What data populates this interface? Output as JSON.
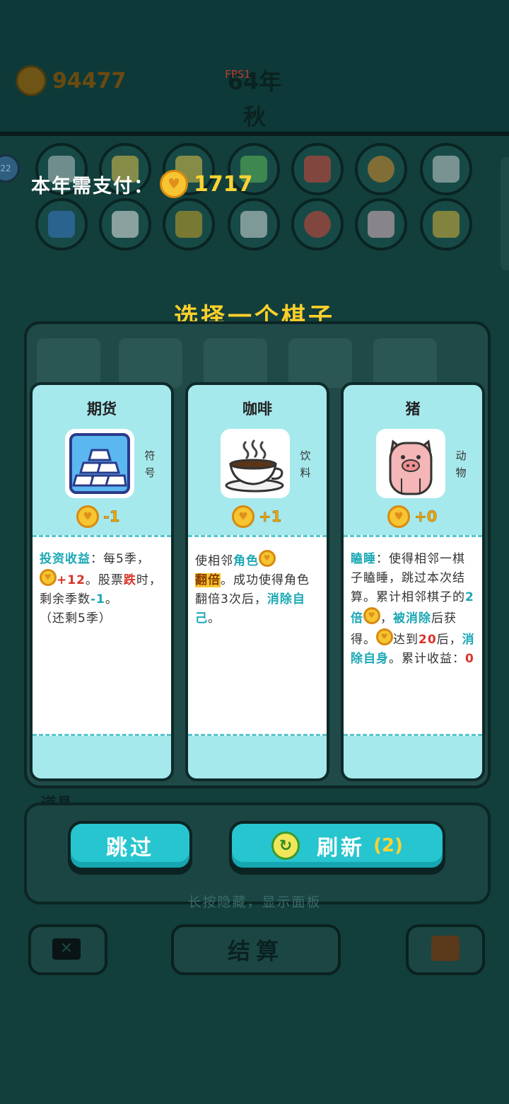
{
  "header": {
    "coins": "94477",
    "year": "64年",
    "season": "秋",
    "fps_label": "FPS1",
    "side_badge": "22"
  },
  "pay": {
    "label": "本年需支付：",
    "amount": "1717"
  },
  "choose_title": "选择一个棋子",
  "cards": [
    {
      "name": "期货",
      "category": "符号",
      "cost": "-1",
      "icon": "gold-bars-icon",
      "desc": {
        "line1_kw": "投资收益",
        "line1_rest": "：每5季，",
        "gain": "+12",
        "line2": "。股票",
        "fall_kw": "跌",
        "line3": "时，剩余季数",
        "minus": "-1",
        "line4": "。",
        "remaining": "（还剩5季）"
      }
    },
    {
      "name": "咖啡",
      "category": "饮料",
      "cost": "+1",
      "icon": "coffee-cup-icon",
      "desc": {
        "p1": "使相邻",
        "kw_role": "角色",
        "kw_double": "翻倍",
        "p2": "。成功使得角色翻倍3次后，",
        "kw_remove": "消除自己",
        "p3": "。"
      }
    },
    {
      "name": "猪",
      "category": "动物",
      "cost": "+0",
      "icon": "pig-icon",
      "desc": {
        "kw_sleep": "瞌睡",
        "p1": "：使得相邻一棋子瞌睡，跳过本次结算。累计相邻棋子的",
        "kw_double": "2倍",
        "p2": "，",
        "kw_removed": "被消除",
        "p3": "后获得。",
        "p4": "达到",
        "limit": "20",
        "p5": "后，",
        "kw_remove_self": "消除自身",
        "p6": "。累计收益：",
        "total": "0"
      }
    }
  ],
  "items_label": "道具",
  "buttons": {
    "skip": "跳过",
    "refresh": "刷新",
    "refresh_count": "(2)",
    "settle": "结算"
  },
  "hint": "长按隐藏，显示面板",
  "colors": {
    "accent_teal": "#27c5cf",
    "coin_gold": "#f6c531",
    "title_yellow": "#ffd02a",
    "keyword_teal": "#1ba8b6",
    "keyword_red": "#d8342a"
  }
}
